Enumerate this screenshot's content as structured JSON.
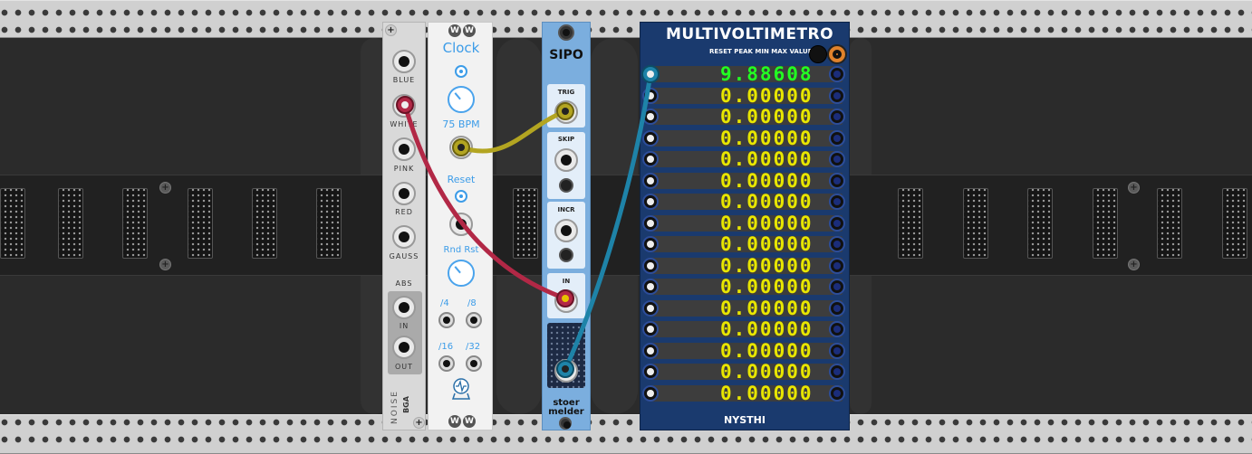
{
  "noise": {
    "outputs": [
      "BLUE",
      "WHITE",
      "PINK",
      "RED",
      "GAUSS"
    ],
    "abs_label": "ABS",
    "in_label": "IN",
    "out_label": "OUT",
    "brand": "NOISE",
    "brand2": "BGA"
  },
  "clock": {
    "title": "Clock",
    "bpm": "75 BPM",
    "reset": "Reset",
    "rnd_rst": "Rnd Rst",
    "div1": "/4",
    "div2": "/8",
    "div3": "/16",
    "div4": "/32",
    "badge": "W"
  },
  "sipo": {
    "title": "SIPO",
    "trig": "TRIG",
    "skip": "SKIP",
    "incr": "INCR",
    "in": "IN",
    "brand1": "stoer",
    "brand2": "melder"
  },
  "multi": {
    "title": "MULTIVOLTIMETRO",
    "subtitle": "RESET PEAK MIN MAX VALUES",
    "footer": "NYSTHI",
    "rows": [
      "9.88608",
      "0.00000",
      "0.00000",
      "0.00000",
      "0.00000",
      "0.00000",
      "0.00000",
      "0.00000",
      "0.00000",
      "0.00000",
      "0.00000",
      "0.00000",
      "0.00000",
      "0.00000",
      "0.00000",
      "0.00000"
    ]
  },
  "colors": {
    "cable_yellow": "#b3a521",
    "cable_red": "#b22846",
    "cable_blue": "#1e83a8",
    "display_yellow": "#e8e600",
    "display_green": "#22ff22"
  }
}
